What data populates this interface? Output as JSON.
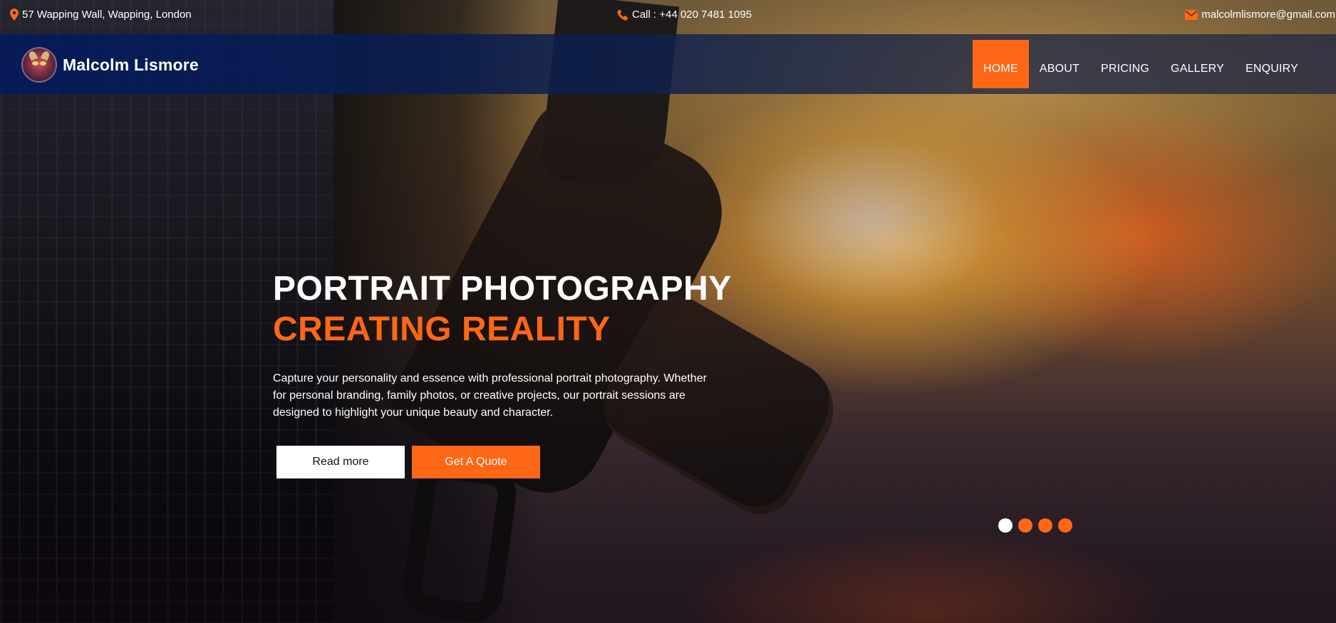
{
  "topbar": {
    "address": "57 Wapping Wall, Wapping, London",
    "phone": "Call : +44 020 7481 1095",
    "email": "malcolmlismore@gmail.com"
  },
  "brand": {
    "name": "Malcolm Lismore"
  },
  "nav": {
    "items": [
      {
        "label": "HOME",
        "active": true
      },
      {
        "label": "ABOUT",
        "active": false
      },
      {
        "label": "PRICING",
        "active": false
      },
      {
        "label": "GALLERY",
        "active": false
      },
      {
        "label": "ENQUIRY",
        "active": false
      }
    ]
  },
  "hero": {
    "title": "PORTRAIT PHOTOGRAPHY",
    "subtitle": "CREATING REALITY",
    "description": "Capture your personality and essence with professional portrait photography. Whether for personal branding, family photos, or creative projects, our portrait sessions are designed to highlight your unique beauty and character.",
    "read_more_label": "Read more",
    "quote_label": "Get A Quote"
  },
  "slider": {
    "slide_count": 4,
    "active_index": 0
  },
  "colors": {
    "accent": "#fd6716",
    "nav_bg": "#031a5c",
    "text": "#ffffff"
  },
  "icons": {
    "address": "map-marker-icon",
    "phone": "phone-icon",
    "email": "envelope-icon"
  }
}
